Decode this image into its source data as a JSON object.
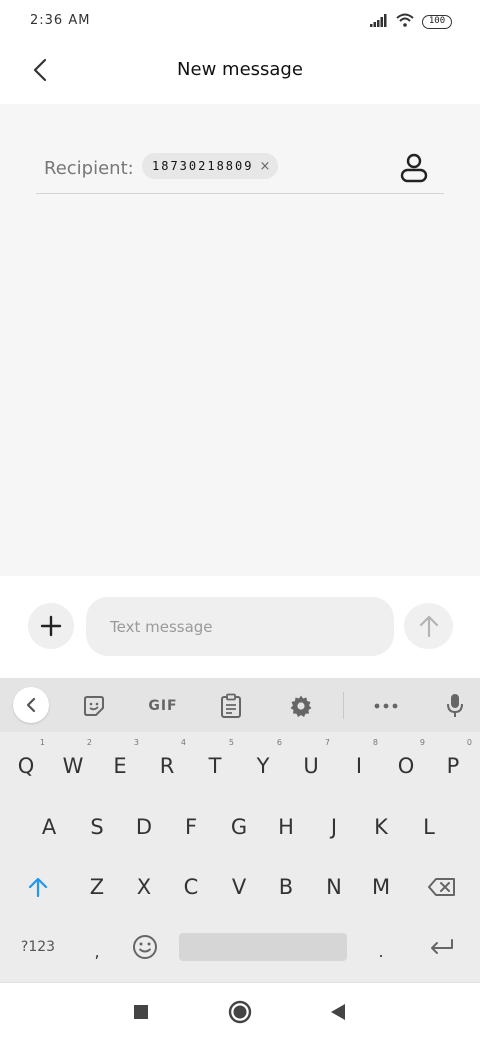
{
  "status_bar": {
    "time": "2:36 AM",
    "battery": "100",
    "icons": [
      "signal-icon",
      "wifi-icon",
      "battery-icon"
    ]
  },
  "header": {
    "title": "New message",
    "back_icon": "chevron-left-icon"
  },
  "recipient": {
    "label": "Recipient:",
    "chip_value": "18730218809",
    "chip_remove": "×",
    "contact_icon": "person-icon"
  },
  "composer": {
    "placeholder": "Text message",
    "attach_icon": "plus-icon",
    "send_icon": "arrow-up-icon"
  },
  "keyboard": {
    "toolbar": {
      "collapse_icon": "chevron-left-icon",
      "sticker_icon": "sticker-icon",
      "gif_label": "GIF",
      "clipboard_icon": "clipboard-icon",
      "settings_icon": "gear-icon",
      "more_icon": "more-dots-icon",
      "mic_icon": "microphone-icon"
    },
    "row1": [
      "Q",
      "W",
      "E",
      "R",
      "T",
      "Y",
      "U",
      "I",
      "O",
      "P"
    ],
    "row1_hints": [
      "1",
      "2",
      "3",
      "4",
      "5",
      "6",
      "7",
      "8",
      "9",
      "0"
    ],
    "row2": [
      "A",
      "S",
      "D",
      "F",
      "G",
      "H",
      "J",
      "K",
      "L"
    ],
    "row3": [
      "Z",
      "X",
      "C",
      "V",
      "B",
      "N",
      "M"
    ],
    "symbols_key": "?123",
    "comma_key": ",",
    "period_key": ".",
    "accent_color": "#2196f3"
  },
  "nav_bar": {
    "icons": [
      "recents-square-icon",
      "home-circle-icon",
      "back-triangle-icon"
    ]
  }
}
